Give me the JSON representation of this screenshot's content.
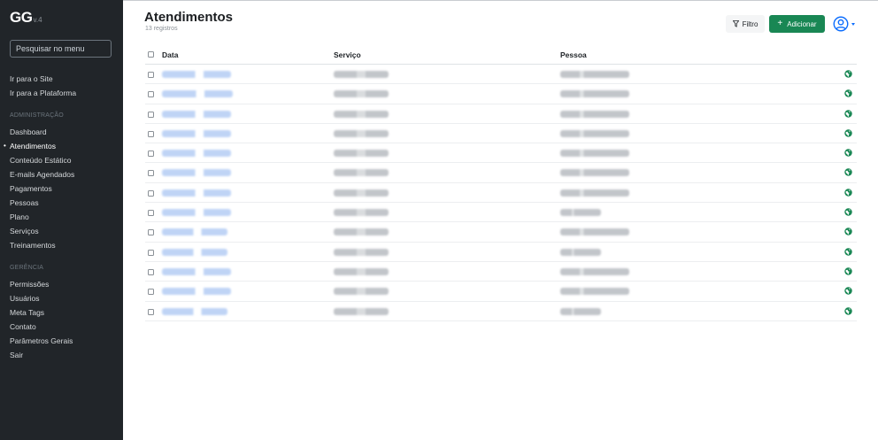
{
  "sidebar": {
    "brand": "GG",
    "version": "v.4",
    "search_placeholder": "Pesquisar no menu",
    "top_links": [
      {
        "label": "Ir para o Site"
      },
      {
        "label": "Ir para a Plataforma"
      }
    ],
    "sections": [
      {
        "heading": "ADMINISTRAÇÃO",
        "items": [
          {
            "label": "Dashboard"
          },
          {
            "label": "Atendimentos",
            "active": true
          },
          {
            "label": "Conteúdo Estático"
          },
          {
            "label": "E-mails Agendados"
          },
          {
            "label": "Pagamentos"
          },
          {
            "label": "Pessoas"
          },
          {
            "label": "Plano"
          },
          {
            "label": "Serviços"
          },
          {
            "label": "Treinamentos"
          }
        ]
      },
      {
        "heading": "GERÊNCIA",
        "items": [
          {
            "label": "Permissões"
          },
          {
            "label": "Usuários"
          },
          {
            "label": "Meta Tags"
          },
          {
            "label": "Contato"
          },
          {
            "label": "Parâmetros Gerais"
          },
          {
            "label": "Sair"
          }
        ]
      }
    ]
  },
  "header": {
    "title": "Atendimentos",
    "subtitle": "13 registros",
    "filter_label": "Filtro",
    "add_label": "Adicionar",
    "filter_icon": "funnel-icon",
    "add_icon": "plus-icon",
    "user_icon": "user-circle-icon"
  },
  "table": {
    "columns": [
      "Data",
      "Serviço",
      "Pessoa"
    ],
    "row_action_icon": "globe-icon",
    "rows": [
      {
        "blurred": true
      },
      {
        "blurred": true
      },
      {
        "blurred": true
      },
      {
        "blurred": true
      },
      {
        "blurred": true
      },
      {
        "blurred": true
      },
      {
        "blurred": true
      },
      {
        "blurred": true
      },
      {
        "blurred": true
      },
      {
        "blurred": true
      },
      {
        "blurred": true
      },
      {
        "blurred": true
      },
      {
        "blurred": true
      }
    ]
  },
  "colors": {
    "sidebar_bg": "#212529",
    "primary": "#0d6efd",
    "success": "#198754",
    "link_blur": "#b9d0f5"
  }
}
